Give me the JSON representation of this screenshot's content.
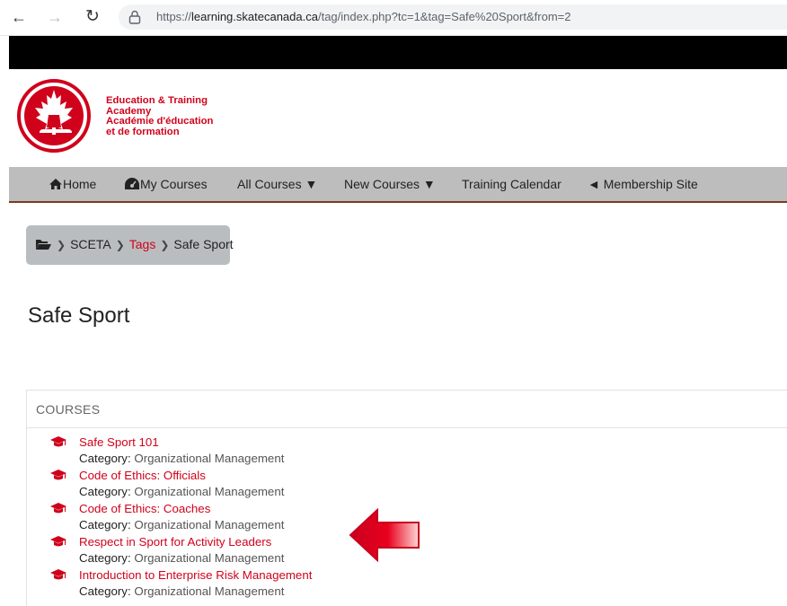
{
  "browser": {
    "url_prefix": "https://",
    "url_host": "learning.skatecanada.ca",
    "url_path": "/tag/index.php?tc=1&tag=Safe%20Sport&from=2",
    "back_icon": "back-arrow-icon",
    "forward_icon": "forward-arrow-icon",
    "reload_icon": "reload-icon",
    "lock_icon": "lock-icon"
  },
  "brand": {
    "line1": "Education & Training",
    "line2": "Academy",
    "line3": "Académie d'éducation",
    "line4": "et de formation",
    "color": "#d0021b"
  },
  "nav": {
    "home": "Home",
    "my_courses": "My Courses",
    "all_courses": "All Courses ▼",
    "new_courses": "New Courses ▼",
    "training_calendar": "Training Calendar",
    "membership_site": "◄ Membership Site"
  },
  "breadcrumb": {
    "items": [
      "SCETA",
      "Tags",
      "Safe Sport"
    ]
  },
  "page": {
    "title": "Safe Sport"
  },
  "courses": {
    "heading": "COURSES",
    "category_label": "Category:",
    "items": [
      {
        "title": "Safe Sport 101",
        "category": "Organizational Management"
      },
      {
        "title": "Code of Ethics: Officials",
        "category": "Organizational Management"
      },
      {
        "title": "Code of Ethics: Coaches",
        "category": "Organizational Management"
      },
      {
        "title": "Respect in Sport for Activity Leaders",
        "category": "Organizational Management"
      },
      {
        "title": "Introduction to Enterprise Risk Management",
        "category": "Organizational Management"
      }
    ]
  }
}
